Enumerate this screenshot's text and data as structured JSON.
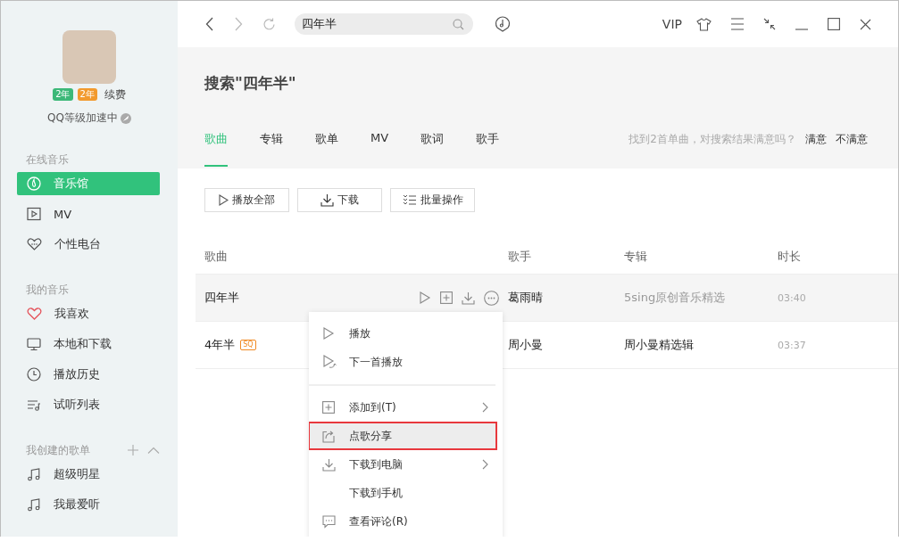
{
  "sidebar": {
    "badges": [
      "2年",
      "2年"
    ],
    "renew": "续费",
    "level_text": "QQ等级加速中",
    "sections": [
      {
        "title": "在线音乐",
        "actions": false,
        "items": [
          {
            "label": "音乐馆",
            "selected": true
          },
          {
            "label": "MV",
            "selected": false
          },
          {
            "label": "个性电台",
            "selected": false
          }
        ]
      },
      {
        "title": "我的音乐",
        "actions": false,
        "items": [
          {
            "label": "我喜欢",
            "selected": false
          },
          {
            "label": "本地和下载",
            "selected": false
          },
          {
            "label": "播放历史",
            "selected": false
          },
          {
            "label": "试听列表",
            "selected": false
          }
        ]
      },
      {
        "title": "我创建的歌单",
        "actions": true,
        "items": [
          {
            "label": "超级明星",
            "selected": false
          },
          {
            "label": "我最爱听",
            "selected": false
          }
        ]
      }
    ]
  },
  "toolbar": {
    "search": {
      "value": "四年半"
    },
    "vip": "VIP"
  },
  "header": {
    "title": "搜索\"四年半\"",
    "tabs": [
      {
        "label": "歌曲",
        "selected": true
      },
      {
        "label": "专辑",
        "selected": false
      },
      {
        "label": "歌单",
        "selected": false
      },
      {
        "label": "MV",
        "selected": false
      },
      {
        "label": "歌词",
        "selected": false
      },
      {
        "label": "歌手",
        "selected": false
      }
    ],
    "feedback": "找到2首单曲，对搜索结果满意吗？",
    "feedback_links": [
      "满意",
      "不满意"
    ]
  },
  "actions": [
    "播放全部",
    "下载",
    "批量操作"
  ],
  "table": {
    "columns": [
      "歌曲",
      "歌手",
      "专辑",
      "时长"
    ],
    "rows": [
      {
        "song": "四年半",
        "badge": "",
        "artist": "葛雨晴",
        "album": "5sing原创音乐精选",
        "album_linked": false,
        "duration": "03:40",
        "hovered": true
      },
      {
        "song": "4年半",
        "badge": "SQ",
        "artist": "周小曼",
        "album": "周小曼精选辑",
        "album_linked": true,
        "duration": "03:37",
        "hovered": false
      }
    ]
  },
  "context_menu": {
    "groups": [
      [
        {
          "label": "播放",
          "submenu": false,
          "selected": false
        },
        {
          "label": "下一首播放",
          "submenu": false,
          "selected": false
        }
      ],
      [
        {
          "label": "添加到(T)",
          "submenu": true,
          "selected": false
        },
        {
          "label": "点歌分享",
          "submenu": false,
          "selected": true
        },
        {
          "label": "下载到电脑",
          "submenu": true,
          "selected": false
        },
        {
          "label": "下载到手机",
          "submenu": false,
          "selected": false
        },
        {
          "label": "查看评论(R)",
          "submenu": false,
          "selected": false
        }
      ]
    ]
  }
}
